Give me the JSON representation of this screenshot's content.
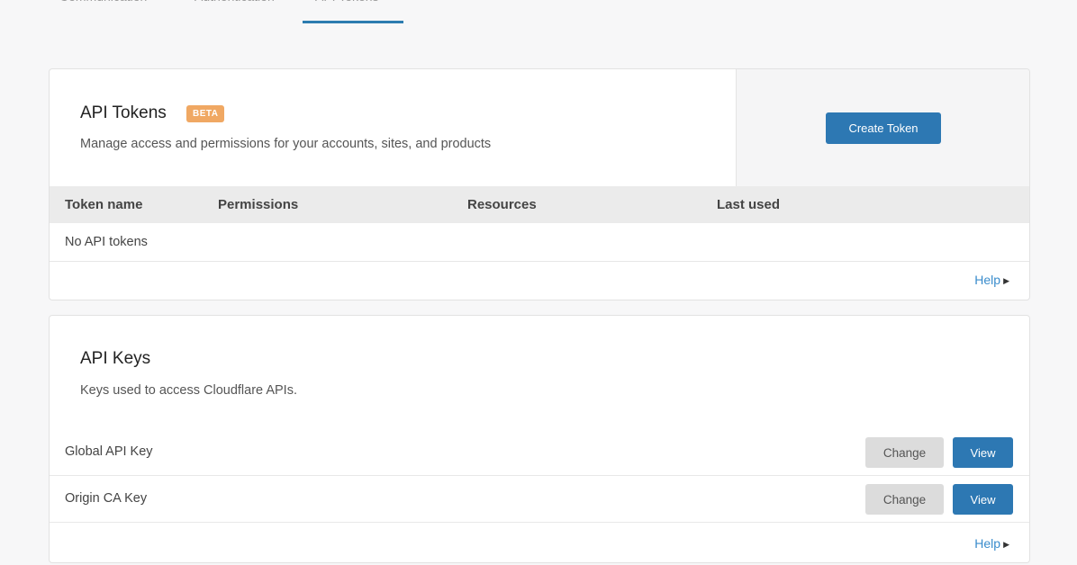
{
  "tabs": [
    {
      "label": "Communication"
    },
    {
      "label": "Authentication"
    },
    {
      "label": "API Tokens"
    }
  ],
  "tokens": {
    "title": "API Tokens",
    "badge": "BETA",
    "description": "Manage access and permissions for your accounts, sites, and products",
    "create_button": "Create Token",
    "columns": [
      "Token name",
      "Permissions",
      "Resources",
      "Last used"
    ],
    "empty_text": "No API tokens",
    "help": "Help"
  },
  "keys": {
    "title": "API Keys",
    "description": "Keys used to access Cloudflare APIs.",
    "rows": [
      {
        "label": "Global API Key",
        "change": "Change",
        "view": "View"
      },
      {
        "label": "Origin CA Key",
        "change": "Change",
        "view": "View"
      }
    ],
    "help": "Help"
  },
  "colors": {
    "accent": "#2d78b3",
    "beta_badge": "#f0a863",
    "link": "#3a8ccc"
  }
}
